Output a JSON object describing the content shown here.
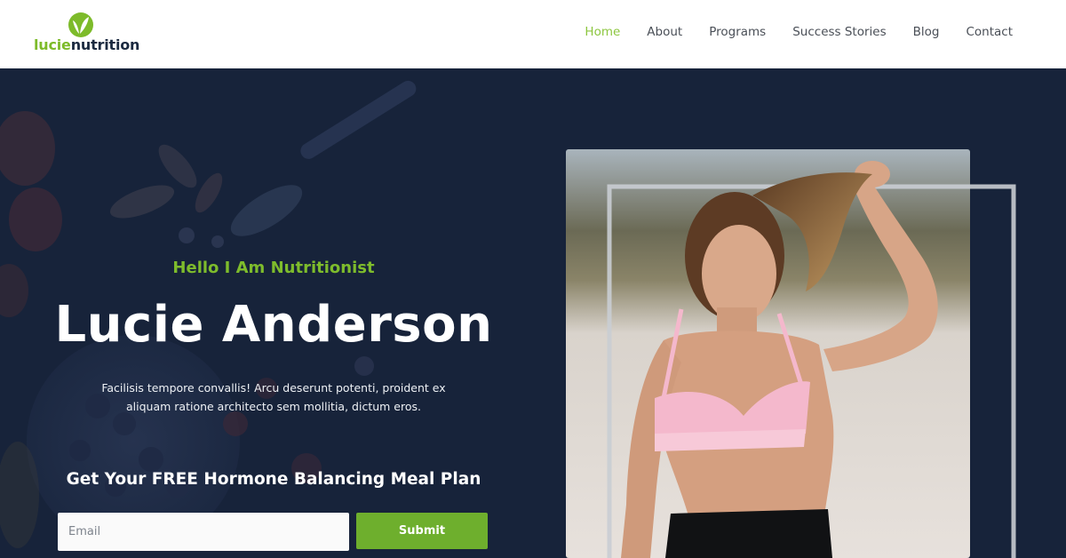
{
  "brand": {
    "name_part1": "lucie",
    "name_part2": "nutrition",
    "logo_icon": "leaf-logo-icon",
    "accent_color": "#8cc63f",
    "dark_color": "#1b2a40"
  },
  "nav": {
    "items": [
      {
        "label": "Home",
        "active": true
      },
      {
        "label": "About",
        "active": false
      },
      {
        "label": "Programs",
        "active": false
      },
      {
        "label": "Success Stories",
        "active": false
      },
      {
        "label": "Blog",
        "active": false
      },
      {
        "label": "Contact",
        "active": false
      }
    ]
  },
  "hero": {
    "tagline": "Hello I Am Nutritionist",
    "name": "Lucie Anderson",
    "intro_line1": "Facilisis tempore convallis! Arcu deserunt potenti, proident ex",
    "intro_line2": "aliquam ratione architecto sem mollitia, dictum eros.",
    "background_color": "#17233a"
  },
  "signup": {
    "title": "Get Your FREE Hormone Balancing Meal Plan",
    "email_placeholder": "Email",
    "email_value": "",
    "submit_label": "Submit",
    "button_color": "#6eaf2d"
  }
}
